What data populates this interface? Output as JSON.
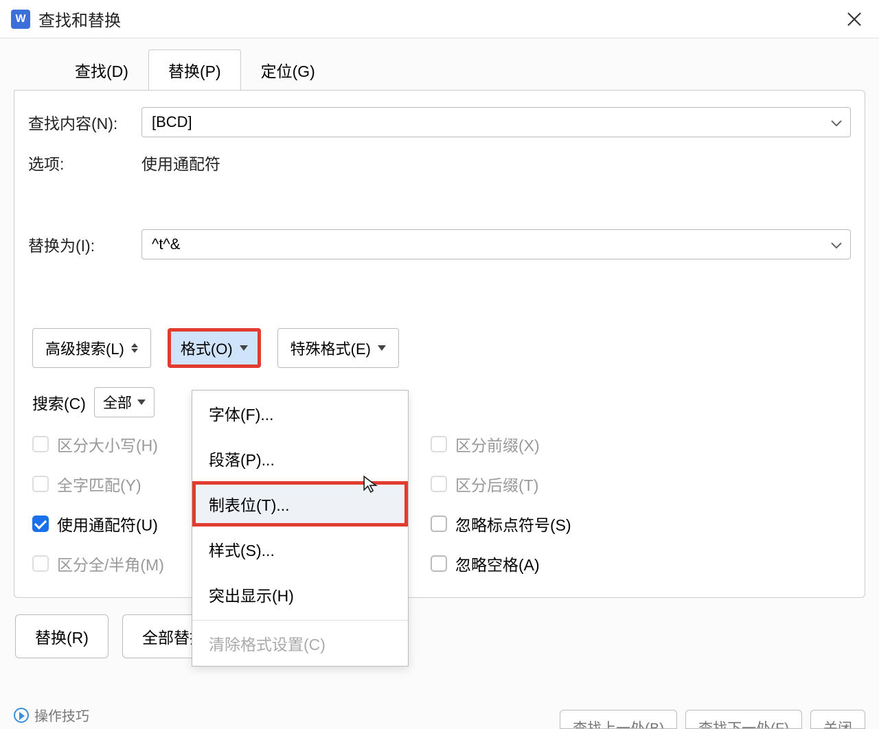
{
  "titlebar": {
    "title": "查找和替换"
  },
  "tabs": {
    "find": "查找(D)",
    "replace": "替换(P)",
    "goto": "定位(G)"
  },
  "form": {
    "find_label": "查找内容(N):",
    "find_value": "[BCD]",
    "options_label": "选项:",
    "options_value": "使用通配符",
    "replace_label": "替换为(I):",
    "replace_value": "^t^&"
  },
  "buttons": {
    "advanced": "高级搜索(L)",
    "format": "格式(O)",
    "special": "特殊格式(E)"
  },
  "search": {
    "label": "搜索(C)",
    "scope": "全部"
  },
  "checks": {
    "match_case": "区分大小写(H)",
    "whole_word": "全字匹配(Y)",
    "wildcard": "使用通配符(U)",
    "full_half": "区分全/半角(M)",
    "prefix": "区分前缀(X)",
    "suffix": "区分后缀(T)",
    "ignore_punct": "忽略标点符号(S)",
    "ignore_space": "忽略空格(A)"
  },
  "format_menu": {
    "font": "字体(F)...",
    "paragraph": "段落(P)...",
    "tabstop": "制表位(T)...",
    "style": "样式(S)...",
    "highlight": "突出显示(H)",
    "clear": "清除格式设置(C)"
  },
  "bottom": {
    "replace": "替换(R)",
    "replace_all": "全部替换(A)"
  },
  "hint": "操作技巧",
  "partial": {
    "find_prev": "查找上一处(B)",
    "find_next": "查找下一处(F)",
    "close": "关闭"
  }
}
